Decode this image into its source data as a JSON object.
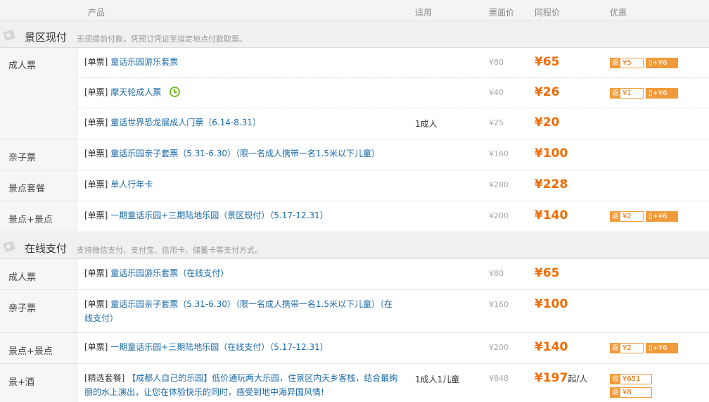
{
  "header": {
    "product": "产品",
    "applies": "适用",
    "face_price": "票面价",
    "tc_price": "同程价",
    "promo": "优惠"
  },
  "sections": [
    {
      "title": "景区现付",
      "desc": "无须提前付款，凭预订凭证至指定地点付款取票。"
    },
    {
      "title": "在线支付",
      "desc": "支持微信支付、支付宝、信用卡、储蓄卡等支付方式。"
    }
  ],
  "groups": [
    {
      "category": "成人票",
      "rows": [
        {
          "tag": "[单票]",
          "name": "童话乐园游乐套票",
          "applies": "",
          "orig": "¥80",
          "price": "¥65",
          "promo": {
            "fan_label": "返",
            "fan": "¥5",
            "phone": "+¥6"
          }
        },
        {
          "tag": "[单票]",
          "name": "摩天轮成人票",
          "applies": "",
          "orig": "¥40",
          "price": "¥26",
          "promo": {
            "fan_label": "返",
            "fan": "¥1",
            "phone": "+¥6"
          },
          "icon": "clock-icon"
        },
        {
          "tag": "[单票]",
          "name": "童话世界恐龙展成人门票（6.14-8.31）",
          "applies": "1成人",
          "orig": "¥25",
          "price": "¥20"
        }
      ]
    },
    {
      "category": "亲子票",
      "rows": [
        {
          "tag": "[单票]",
          "name": "童话乐园亲子套票（5.31-6.30）（限一名成人携带一名1.5米以下儿童）",
          "applies": "",
          "orig": "¥160",
          "price": "¥100"
        }
      ]
    },
    {
      "category": "景点套餐",
      "rows": [
        {
          "tag": "[单票]",
          "name": "单人行年卡",
          "applies": "",
          "orig": "¥280",
          "price": "¥228"
        }
      ]
    },
    {
      "category": "景点+景点",
      "rows": [
        {
          "tag": "[单票]",
          "name": "一期童话乐园+三期陆地乐园（景区现付）（5.17-12.31）",
          "applies": "",
          "orig": "¥200",
          "price": "¥140",
          "promo": {
            "fan_label": "返",
            "fan": "¥2",
            "phone": "+¥6"
          }
        }
      ]
    },
    {
      "category": "成人票",
      "rows": [
        {
          "tag": "[单票]",
          "name": "童话乐园游乐套票（在线支付）",
          "applies": "",
          "orig": "¥80",
          "price": "¥65"
        }
      ]
    },
    {
      "category": "亲子票",
      "rows": [
        {
          "tag": "[单票]",
          "name": "童话乐园亲子套票（5.31-6.30）（限一名成人携带一名1.5米以下儿童）（在",
          "name2": "线支付）",
          "applies": "",
          "orig": "¥160",
          "price": "¥100"
        }
      ]
    },
    {
      "category": "景点+景点",
      "rows": [
        {
          "tag": "[单票]",
          "name": "一期童话乐园+三期陆地乐园（在线支付）（5.17-12.31）",
          "applies": "",
          "orig": "¥200",
          "price": "¥140",
          "promo": {
            "fan_label": "返",
            "fan": "¥2",
            "phone": "+¥6"
          }
        }
      ]
    },
    {
      "category": "景+酒",
      "rows": [
        {
          "tag": "[精选套餐]",
          "name": "【成都人自己的乐园】",
          "desc1": "低价通玩两大乐园，住景区内天乡客栈，结合最绚",
          "desc2": "丽的水上演出，让您在体验快乐的同时，感受到地中海异国风情!",
          "applies": "1成人1儿童",
          "orig": "¥848",
          "price": "¥197",
          "price_suffix": "起/人",
          "promo": {
            "save_label": "省",
            "save": "¥651",
            "fan_label": "返",
            "fan": "¥8"
          }
        }
      ]
    }
  ],
  "phone_icon_glyph": "▯",
  "colors": {
    "accent": "#f06b00",
    "link": "#1a6aa8",
    "badge": "#f19a3a",
    "clock": "#78b82a"
  }
}
